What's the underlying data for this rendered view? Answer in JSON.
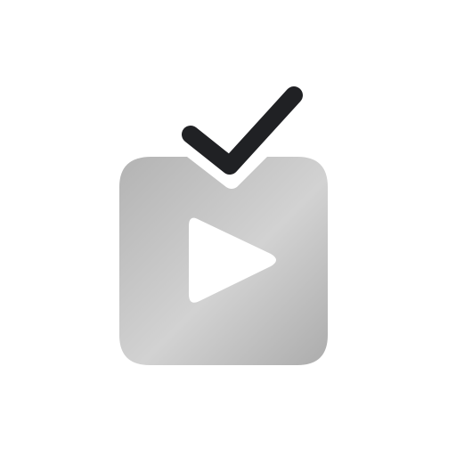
{
  "icon": {
    "name": "tv-play-checkmark-icon",
    "body_gradient": [
      "#b3b3b3",
      "#d2d2d2",
      "#acacac"
    ],
    "play_color": "#ffffff",
    "check_color": "#202124",
    "background": "#ffffff"
  }
}
